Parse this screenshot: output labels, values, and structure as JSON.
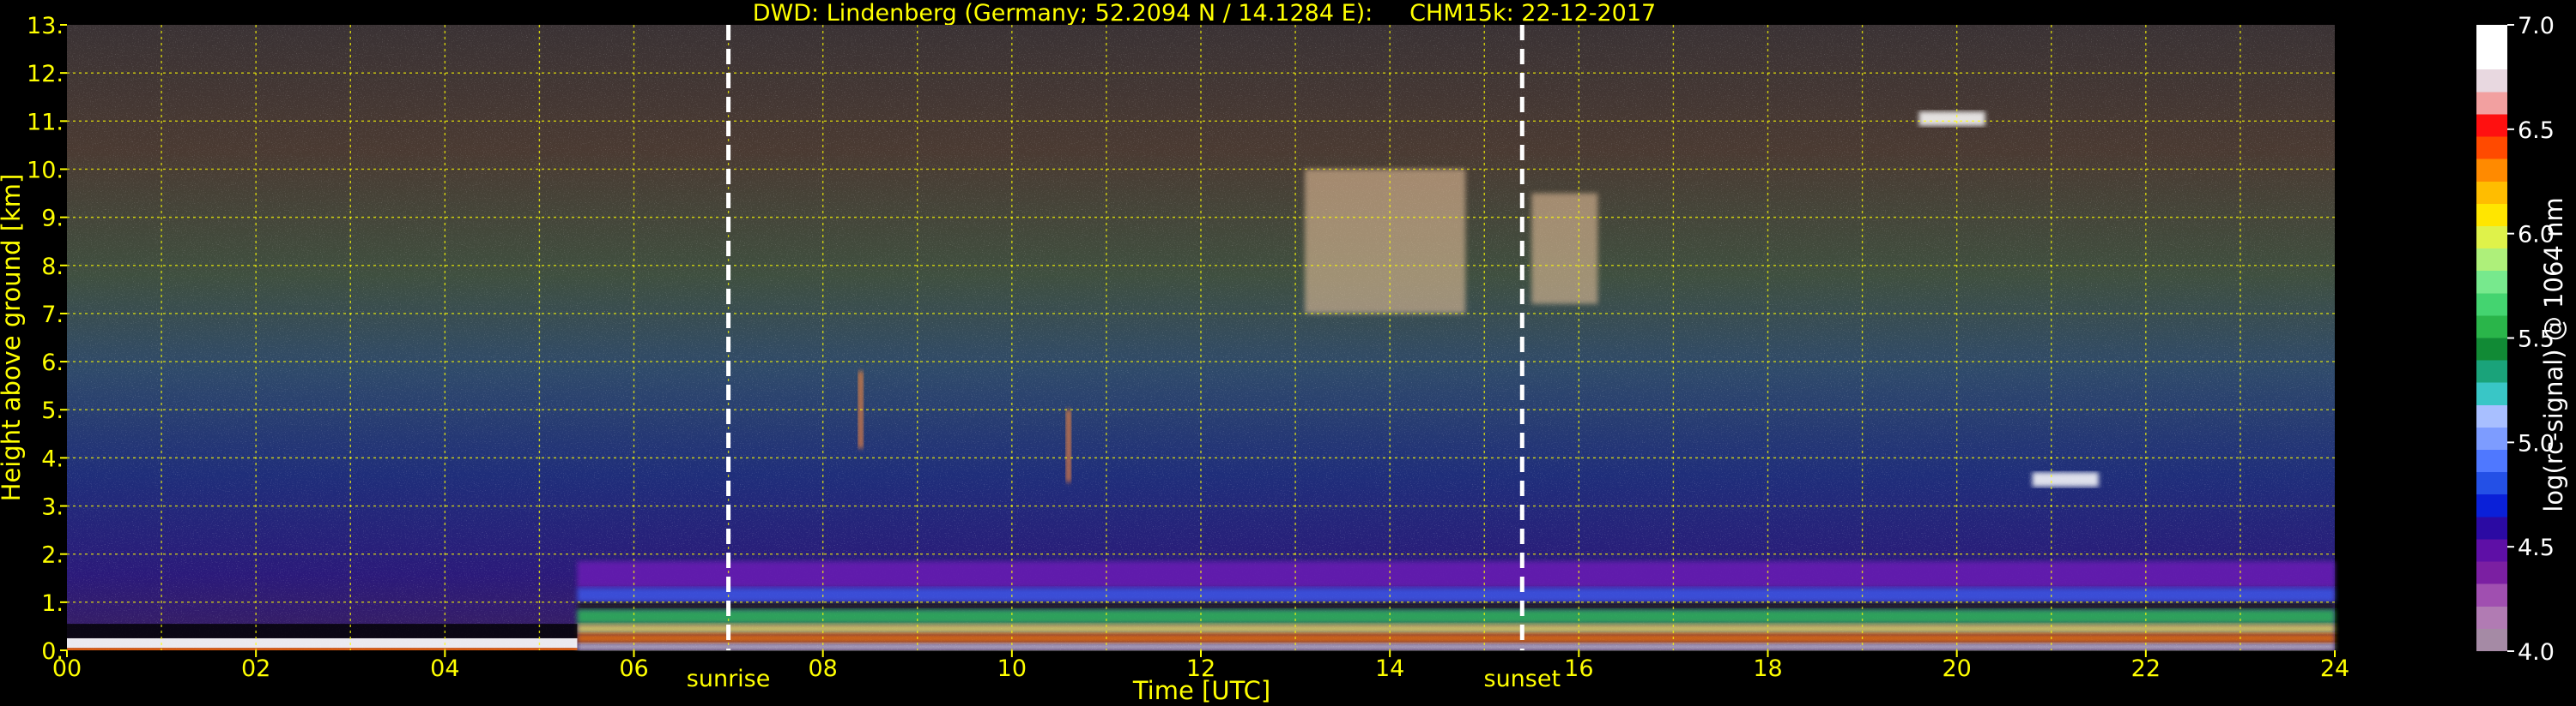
{
  "chart_data": {
    "type": "heatmap",
    "title": "DWD: Lindenberg (Germany; 52.2094 N / 14.1284 E):     CHM15k: 22-12-2017",
    "xlabel": "Time [UTC]",
    "ylabel": "Height above ground [km]",
    "xlim": [
      0,
      24
    ],
    "ylim": [
      0,
      13
    ],
    "x_ticks": [
      "00",
      "02",
      "04",
      "06",
      "08",
      "10",
      "12",
      "14",
      "16",
      "18",
      "20",
      "22",
      "24"
    ],
    "y_ticks": [
      "0.",
      "1.",
      "2.",
      "3.",
      "4.",
      "5.",
      "6.",
      "7.",
      "8.",
      "9.",
      "10.",
      "11.",
      "12.",
      "13."
    ],
    "grid": true,
    "markers": [
      {
        "label": "sunrise",
        "x": 7.0
      },
      {
        "label": "sunset",
        "x": 15.4
      }
    ],
    "colorbar": {
      "label": "log(rc-signal) @ 1064 nm",
      "range": [
        4.0,
        7.0
      ],
      "ticks": [
        "4.0",
        "4.5",
        "5.0",
        "5.5",
        "6.0",
        "6.5",
        "7.0"
      ],
      "colors": [
        "#a58aa5",
        "#b17bb3",
        "#a04fb0",
        "#7b1fa2",
        "#5e0fa6",
        "#2b0aa3",
        "#0a20d8",
        "#2450e6",
        "#4f78ff",
        "#7d9cff",
        "#a8bfff",
        "#39c6c6",
        "#1aa37a",
        "#118a35",
        "#2ab54a",
        "#44d470",
        "#77e98d",
        "#aef07a",
        "#dff24a",
        "#ffe600",
        "#ffbd00",
        "#ff8a00",
        "#ff4a00",
        "#ff1010",
        "#f2a0a0",
        "#e8d8e0",
        "#ffffff",
        "#ffffff"
      ]
    },
    "features": [
      {
        "name": "boundary layer",
        "x_range": [
          5.4,
          24
        ],
        "top_km": 1.85
      },
      {
        "name": "surface layer",
        "x_range": [
          0,
          5.4
        ],
        "top_km": 0.25
      },
      {
        "name": "cirrus",
        "x_range": [
          13.1,
          14.8
        ],
        "base_km": 7.0,
        "top_km": 10.0
      },
      {
        "name": "cirrus",
        "x_range": [
          15.5,
          16.2
        ],
        "base_km": 7.2,
        "top_km": 9.5
      },
      {
        "name": "virga streak",
        "x": 8.4,
        "base_km": 4.2,
        "top_km": 5.8
      },
      {
        "name": "virga streak",
        "x": 10.6,
        "base_km": 3.5,
        "top_km": 5.0
      },
      {
        "name": "cloud",
        "x_range": [
          20.8,
          21.5
        ],
        "top_km": 3.7
      },
      {
        "name": "high cloud",
        "x_range": [
          19.6,
          20.3
        ],
        "top_km": 11.2
      }
    ]
  }
}
